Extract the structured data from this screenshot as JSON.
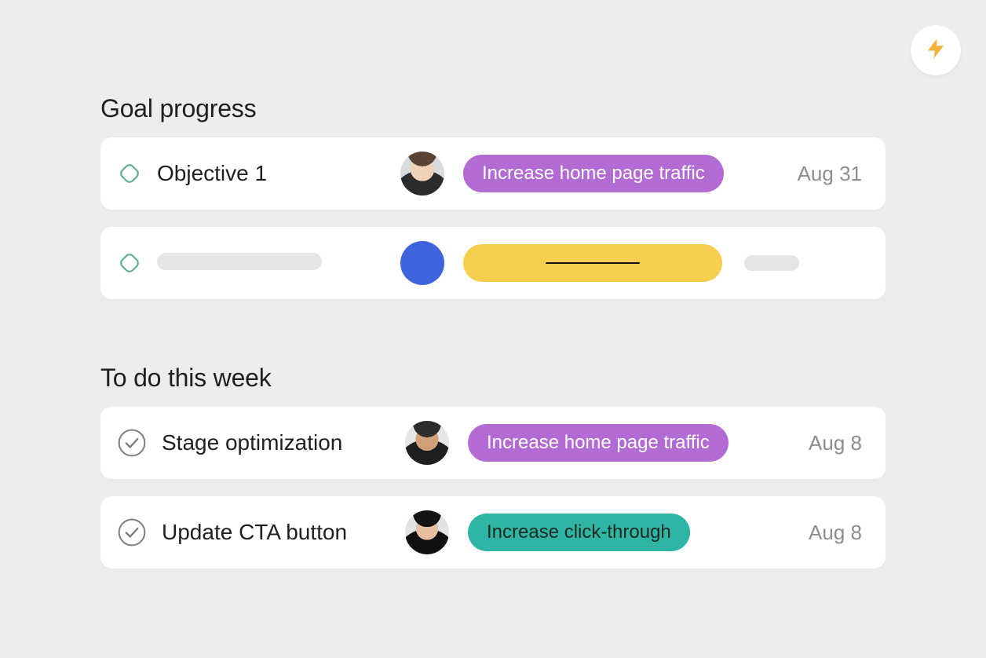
{
  "colors": {
    "purple": "#b36bd4",
    "teal": "#2fb5a4",
    "yellow": "#f6cf4f",
    "blue": "#3f63dd",
    "iconGreen": "#66b29a",
    "textMuted": "#8b8e91"
  },
  "sections": {
    "goals": {
      "title": "Goal progress",
      "items": [
        {
          "title": "Objective 1",
          "tag": "Increase home page traffic",
          "tagColor": "purple",
          "date": "Aug 31",
          "avatar": "person-1"
        },
        {
          "placeholder": true,
          "tagColor": "yellow",
          "avatar": "solid-blue"
        }
      ]
    },
    "todo": {
      "title": "To do this week",
      "items": [
        {
          "title": "Stage optimization",
          "tag": "Increase home page traffic",
          "tagColor": "purple",
          "date": "Aug 8",
          "avatar": "person-2"
        },
        {
          "title": "Update CTA button",
          "tag": "Increase click-through",
          "tagColor": "teal",
          "date": "Aug 8",
          "avatar": "person-3"
        }
      ]
    }
  },
  "fab": {
    "icon": "lightning-icon"
  }
}
